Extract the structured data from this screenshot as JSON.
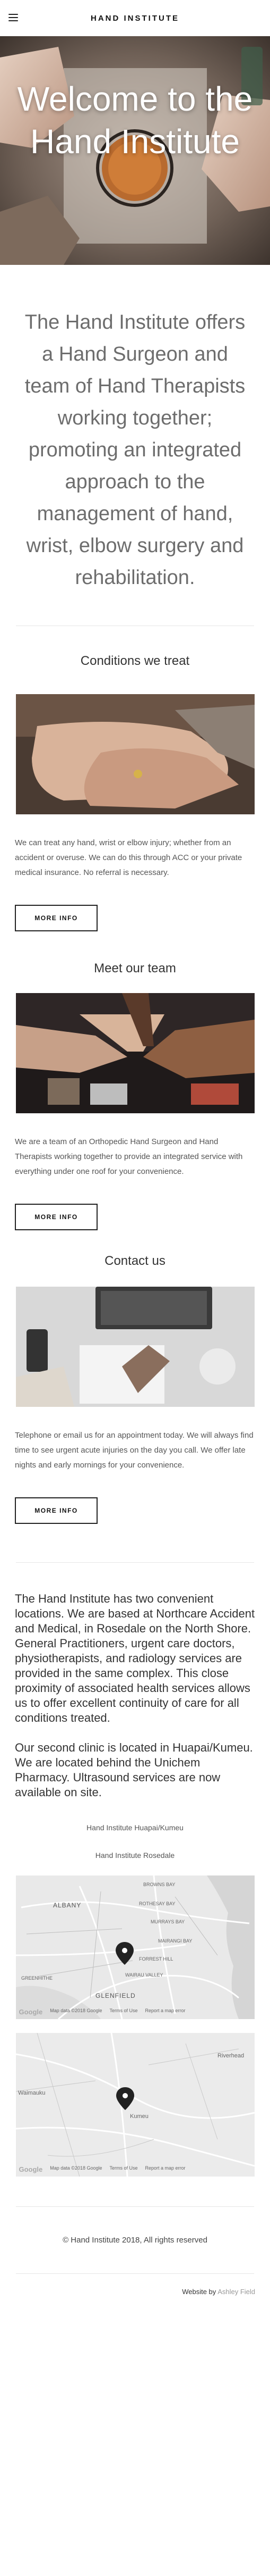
{
  "header": {
    "site_title": "HAND INSTITUTE",
    "menu_icon": "hamburger-icon"
  },
  "hero": {
    "title": "Welcome to the Hand Institute"
  },
  "intro": {
    "text": "The Hand Institute offers a Hand Surgeon and team of Hand Therapists working together; promoting an integrated approach to the management of hand, wrist, elbow surgery and rehabilitation."
  },
  "sections": [
    {
      "heading": "Conditions we treat",
      "text": "We can treat any hand, wrist or elbow injury; whether from an accident or overuse. We can do this through ACC or your private medical insurance. No referral is necessary.",
      "button": "MORE INFO"
    },
    {
      "heading": "Meet our team",
      "text": "We are a team of an Orthopedic Hand Surgeon and Hand Therapists working together to provide an integrated service with everything under one roof for your convenience.",
      "button": "MORE INFO"
    },
    {
      "heading": "Contact us",
      "text": "Telephone or email us for an appointment today.  We will always find time to see urgent acute injuries on the day you call. We offer late nights and early mornings for your convenience.",
      "button": "MORE INFO"
    }
  ],
  "about": {
    "p1": "The Hand Institute has two convenient locations. We are based at Northcare Accident and Medical, in Rosedale on the North Shore. General Practitioners, urgent care doctors, physiotherapists, and radiology services are provided in the same complex. This close proximity of associated health services allows us to offer excellent continuity of care for all conditions treated.",
    "p2": "Our second clinic is located in Huapai/Kumeu.  We are located behind the Unichem Pharmacy. Ultrasound services are now available on site."
  },
  "locations": {
    "label_1": "Hand Institute Huapai/Kumeu",
    "label_2": "Hand Institute Rosedale"
  },
  "map1": {
    "labels": [
      "ALBANY",
      "BROWNS BAY",
      "ROTHESAY BAY",
      "MURRAYS BAY",
      "MAIRANGI BAY",
      "FORREST HILL",
      "WAIRAU VALLEY",
      "GREENHITHE",
      "GLENFIELD"
    ],
    "google": "Google",
    "attribution": "Map data ©2018 Google",
    "terms": "Terms of Use",
    "report": "Report a map error"
  },
  "map2": {
    "labels": [
      "Riverhead",
      "Waimauku",
      "Kumeu"
    ],
    "google": "Google",
    "attribution": "Map data ©2018 Google",
    "terms": "Terms of Use",
    "report": "Report a map error"
  },
  "footer": {
    "copyright": "© Hand Institute 2018, All rights reserved",
    "credit_prefix": "Website by",
    "credit_name": "Ashley Field"
  }
}
